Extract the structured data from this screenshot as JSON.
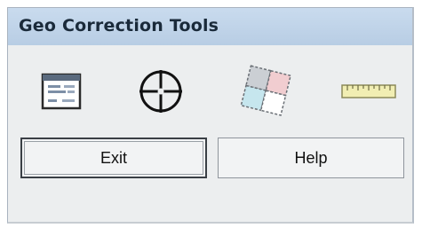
{
  "window": {
    "title": "Geo Correction Tools"
  },
  "toolbar": {
    "tools": [
      {
        "name": "layer-info",
        "icon": "layer-info-icon"
      },
      {
        "name": "crosshair",
        "icon": "crosshair-icon"
      },
      {
        "name": "tiles",
        "icon": "tiles-icon"
      },
      {
        "name": "ruler",
        "icon": "ruler-icon"
      }
    ]
  },
  "buttons": {
    "exit_label": "Exit",
    "help_label": "Help"
  },
  "colors": {
    "title_bar": "#c2d6ec",
    "client_bg": "#eceeef"
  }
}
